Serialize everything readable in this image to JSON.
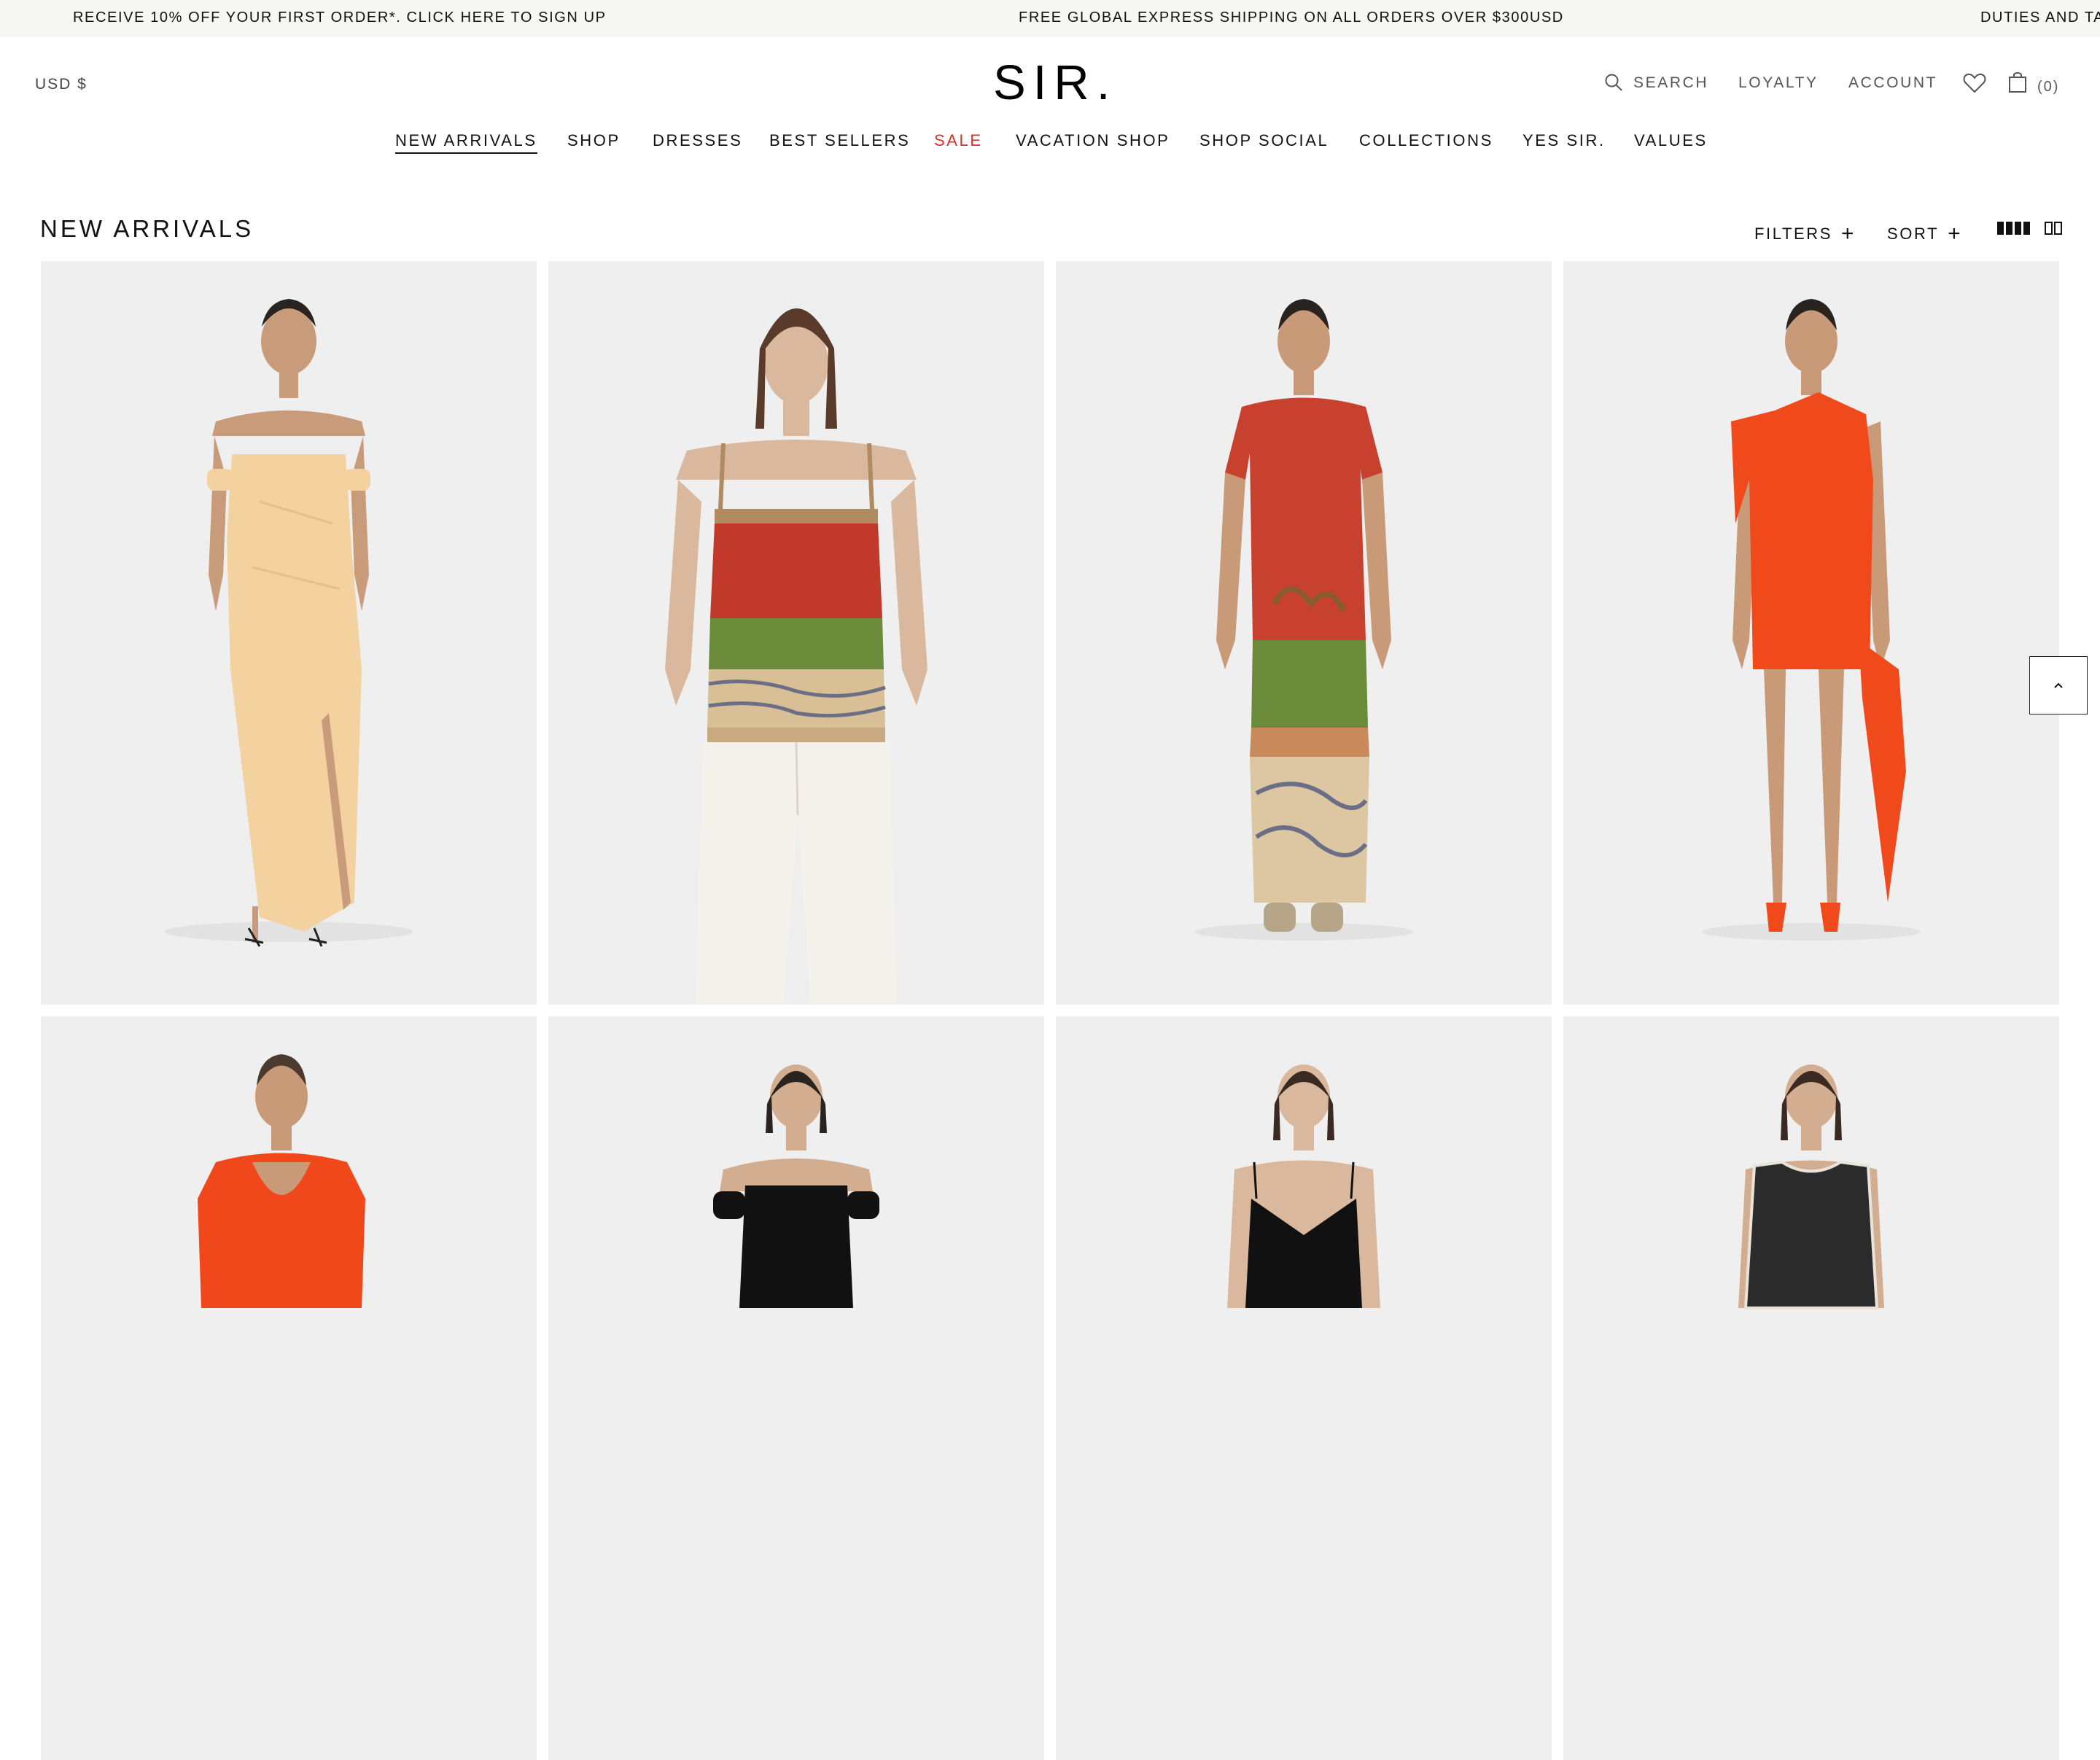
{
  "announcement": {
    "left": "RECEIVE 10% OFF YOUR FIRST ORDER*. CLICK HERE TO SIGN UP",
    "center": "FREE GLOBAL EXPRESS SHIPPING ON ALL ORDERS OVER $300USD",
    "right": "DUTIES AND TA"
  },
  "header": {
    "currency": "USD $",
    "logo": "SIR.",
    "search_label": "SEARCH",
    "loyalty_label": "LOYALTY",
    "account_label": "ACCOUNT",
    "bag_count": "(0)",
    "icons": [
      "search-icon",
      "heart-icon",
      "shopping-bag-icon"
    ]
  },
  "nav": {
    "items": [
      {
        "label": "NEW ARRIVALS",
        "active": true
      },
      {
        "label": "SHOP"
      },
      {
        "label": "DRESSES"
      },
      {
        "label": "BEST SELLERS"
      },
      {
        "label": "SALE",
        "color": "#d1332e"
      },
      {
        "label": "VACATION SHOP"
      },
      {
        "label": "SHOP SOCIAL"
      },
      {
        "label": "COLLECTIONS"
      },
      {
        "label": "YES SIR."
      },
      {
        "label": "VALUES"
      }
    ]
  },
  "listing": {
    "title": "NEW ARRIVALS",
    "filters_label": "FILTERS",
    "sort_label": "SORT",
    "plus": "+",
    "view_icons": [
      "grid-four-icon",
      "grid-two-icon"
    ]
  },
  "products": [
    {
      "garment": "strapless-gathered-maxi-dress",
      "color": "#f3d29f"
    },
    {
      "garment": "printed-mesh-tube-top-with-white-jeans",
      "color": "#c0392b"
    },
    {
      "garment": "printed-mesh-tee-maxi-dress",
      "color": "#c8412f"
    },
    {
      "garment": "asymmetric-drape-mini-dress",
      "color": "#f04a1c"
    },
    {
      "garment": "long-sleeve-scoop-top",
      "color": "#f0481a"
    },
    {
      "garment": "black-off-shoulder-dress",
      "color": "#111111"
    },
    {
      "garment": "black-slip-dress",
      "color": "#111111"
    },
    {
      "garment": "black-sheer-tank",
      "color": "#2b2b2b"
    }
  ],
  "back_to_top_icon": "chevron-up-icon"
}
